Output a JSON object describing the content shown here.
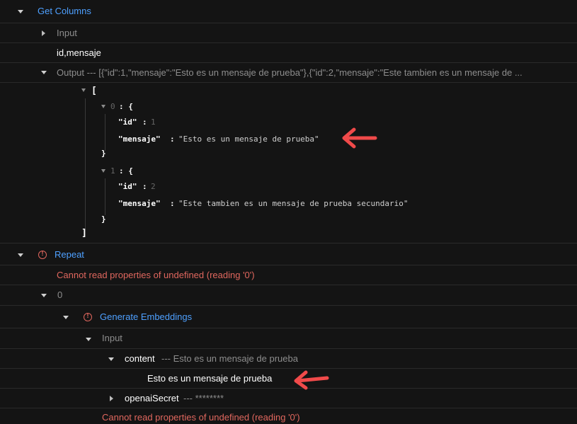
{
  "tree": {
    "get_columns": {
      "title": "Get Columns",
      "input_label": "Input",
      "input_value": "id,mensaje",
      "output_label": "Output --- [{\"id\":1,\"mensaje\":\"Esto es un mensaje de prueba\"},{\"id\":2,\"mensaje\":\"Este tambien es un mensaje de ..."
    },
    "json": {
      "open_bracket": "[",
      "close_bracket": "]",
      "items": [
        {
          "index": "0",
          "open": ": {",
          "key_id": "\"id\"",
          "colon": ":",
          "val_id": "1",
          "key_msg": "\"mensaje\"",
          "val_msg": "\"Esto es un mensaje de prueba\"",
          "close": "}"
        },
        {
          "index": "1",
          "open": ": {",
          "key_id": "\"id\"",
          "colon": ":",
          "val_id": "2",
          "key_msg": "\"mensaje\"",
          "val_msg": "\"Este tambien es un mensaje de prueba secundario\"",
          "close": "}"
        }
      ]
    },
    "repeat": {
      "title": "Repeat",
      "error": "Cannot read properties of undefined (reading '0')",
      "index_label": "0"
    },
    "generate_embeddings": {
      "title": "Generate Embeddings",
      "input_label": "Input",
      "content_label": "content",
      "content_summary": " --- Esto es un mensaje de prueba",
      "content_value": "Esto es un mensaje de prueba",
      "secret_label": "openaiSecret",
      "secret_summary": " --- ********",
      "error": "Cannot read properties of undefined (reading '0')"
    }
  },
  "colors": {
    "background": "#141414",
    "link_blue": "#4ea0ff",
    "error_red": "#e0675e",
    "annotation_arrow": "#f04a4a"
  }
}
